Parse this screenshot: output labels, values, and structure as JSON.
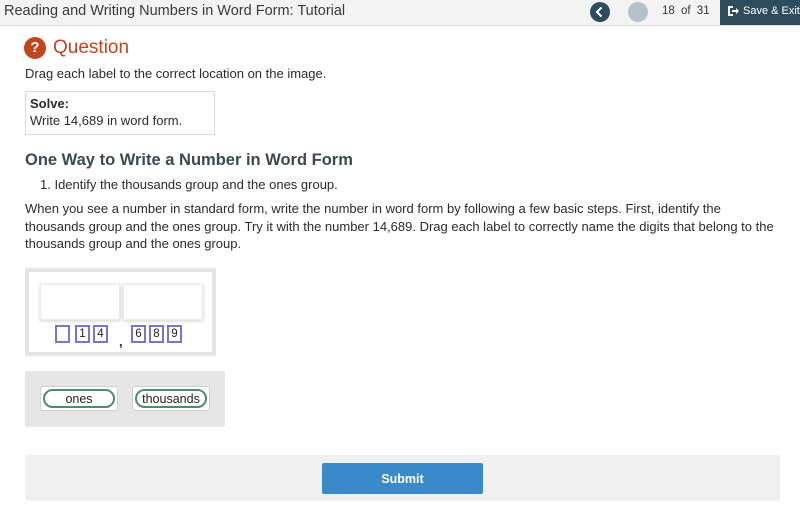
{
  "header": {
    "title": "Reading and Writing Numbers in Word Form: Tutorial",
    "page_current": "18",
    "page_of": "of",
    "page_total": "31",
    "save_exit_label": "Save & Exit",
    "back_icon": "chevron-left-icon",
    "save_icon": "exit-icon"
  },
  "question": {
    "heading": "Question",
    "icon": "?",
    "instructions": "Drag each label to the correct location on the image.",
    "solve_label": "Solve:",
    "solve_text": "Write 14,689 in word form."
  },
  "content": {
    "section_title": "One Way to Write a Number in Word Form",
    "step": "1. Identify the thousands group and the ones group.",
    "paragraph": "When you see a number in standard form, write the number in word form by following a few basic steps. First, identify the thousands group and the ones group. Try it with the number 14,689. Drag each label to correctly name the digits that belong to the thousands group and the ones group."
  },
  "image": {
    "digits": [
      "",
      "1",
      "4",
      "6",
      "8",
      "9"
    ],
    "comma": ","
  },
  "labels": [
    "ones",
    "thousands"
  ],
  "submit_label": "Submit",
  "colors": {
    "accent_dark": "#2d4d5c",
    "question_accent": "#c0461d",
    "submit": "#3a8ac9",
    "chip_border": "#4a8f6a",
    "digit_border": "#7a75c9"
  }
}
